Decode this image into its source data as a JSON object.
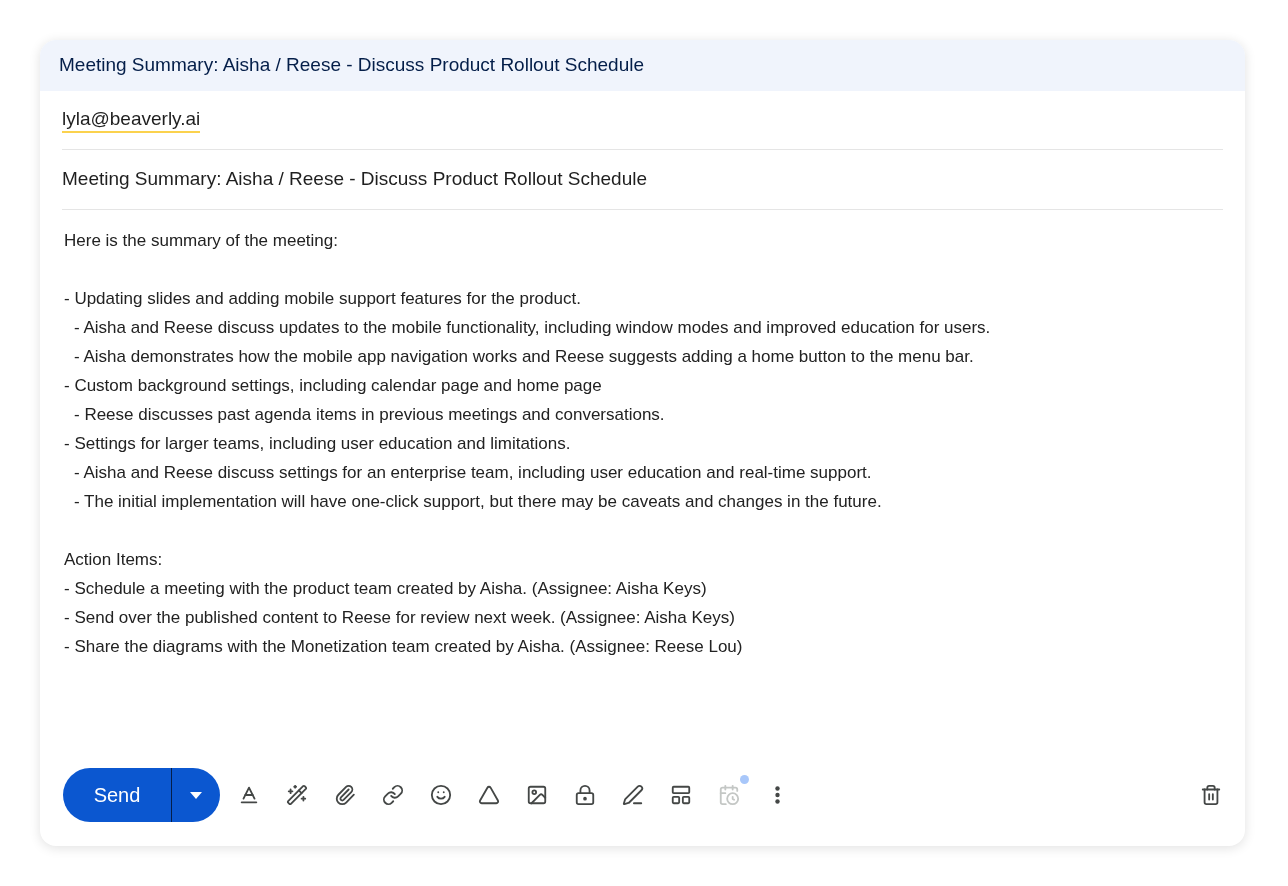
{
  "window": {
    "title": "Meeting Summary: Aisha / Reese - Discuss Product Rollout Schedule"
  },
  "recipients": [
    {
      "address": "lyla@beaverly.ai"
    }
  ],
  "subject": "Meeting Summary: Aisha / Reese - Discuss Product Rollout Schedule",
  "body": [
    {
      "heading": "Here is the summary of the meeting:"
    },
    {
      "items": [
        {
          "text": "- Updating slides and adding mobile support features for the product.",
          "children": [
            {
              "text": "- Aisha and Reese discuss updates to the mobile functionality, including window modes and improved education for users."
            },
            {
              "text": "- Aisha demonstrates how the mobile app navigation works and Reese suggests adding a home button to the menu bar."
            }
          ]
        },
        {
          "text": "- Custom background settings, including calendar page and home page",
          "children": [
            {
              "text": "- Reese discusses past agenda items in previous meetings and conversations."
            }
          ]
        },
        {
          "text": "- Settings for larger teams, including user education and limitations.",
          "children": [
            {
              "text": "- Aisha and Reese discuss settings for an enterprise team, including user education and real-time support."
            },
            {
              "text": "- The initial implementation will have one-click support, but there may be caveats and changes in the future."
            }
          ]
        }
      ]
    },
    {
      "heading": "Action Items:",
      "items": [
        {
          "text": "- Schedule a meeting with the product team created by Aisha. (Assignee: Aisha Keys)"
        },
        {
          "text": "- Send over the published content to Reese for review next week. (Assignee: Aisha Keys)"
        },
        {
          "text": "- Share the diagrams with the Monetization team created by Aisha. (Assignee: Reese Lou)"
        }
      ]
    }
  ],
  "send_button": "Send",
  "toolbar": [
    {
      "kind": "format",
      "disabled": false
    },
    {
      "kind": "ai-write",
      "disabled": false
    },
    {
      "kind": "attach",
      "disabled": false
    },
    {
      "kind": "link",
      "disabled": false
    },
    {
      "kind": "emoji",
      "disabled": false
    },
    {
      "kind": "drive",
      "disabled": false
    },
    {
      "kind": "photo",
      "disabled": false
    },
    {
      "kind": "confidential",
      "disabled": false
    },
    {
      "kind": "signature",
      "disabled": false
    },
    {
      "kind": "layout",
      "disabled": false
    },
    {
      "kind": "schedule",
      "disabled": true,
      "badge": true
    },
    {
      "kind": "more",
      "disabled": false
    }
  ]
}
